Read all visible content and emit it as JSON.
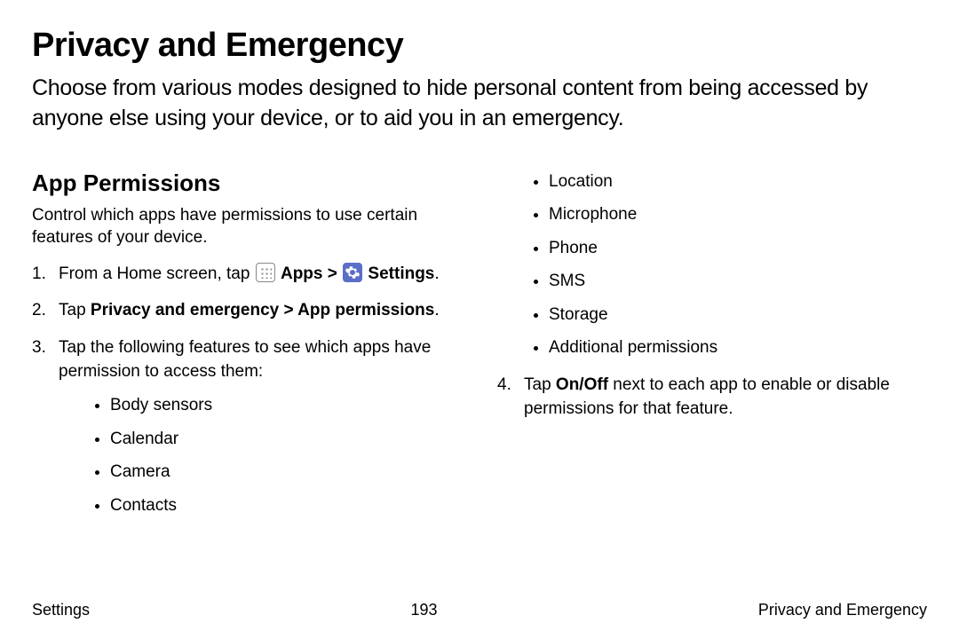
{
  "title": "Privacy and Emergency",
  "intro": "Choose from various modes designed to hide personal content from being accessed by anyone else using your device, or to aid you in an emergency.",
  "section": {
    "title": "App Permissions",
    "desc": "Control which apps have permissions to use certain features of your device.",
    "step1_pre": "From a Home screen, tap ",
    "step1_apps": "Apps",
    "step1_sep": " > ",
    "step1_settings": "Settings",
    "step1_end": ".",
    "step2_pre": "Tap ",
    "step2_bold": "Privacy and emergency > App permissions",
    "step2_end": ".",
    "step3": "Tap the following features to see which apps have permission to access them:",
    "features_left": [
      "Body sensors",
      "Calendar",
      "Camera",
      "Contacts"
    ],
    "features_right": [
      "Location",
      "Microphone",
      "Phone",
      "SMS",
      "Storage",
      "Additional permissions"
    ],
    "step4_pre": "Tap ",
    "step4_bold": "On/Off",
    "step4_post": " next to each app to enable or disable permissions for that feature."
  },
  "footer": {
    "left": "Settings",
    "center": "193",
    "right": "Privacy and Emergency"
  }
}
